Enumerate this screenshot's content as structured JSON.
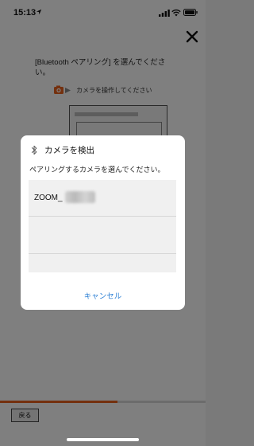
{
  "status_bar": {
    "time": "15:13"
  },
  "page": {
    "instruction": "[Bluetooth ペアリング] を選んでください。",
    "camera_hint": "カメラを操作してください",
    "progress": 0.57,
    "back_label": "戻る"
  },
  "dialog": {
    "title": "カメラを検出",
    "subtitle": "ペアリングするカメラを選んでください。",
    "devices": [
      {
        "name": "ZOOM_"
      }
    ],
    "cancel_label": "キャンセル"
  },
  "colors": {
    "accent": "#e8601c",
    "link": "#2b7fd4"
  }
}
